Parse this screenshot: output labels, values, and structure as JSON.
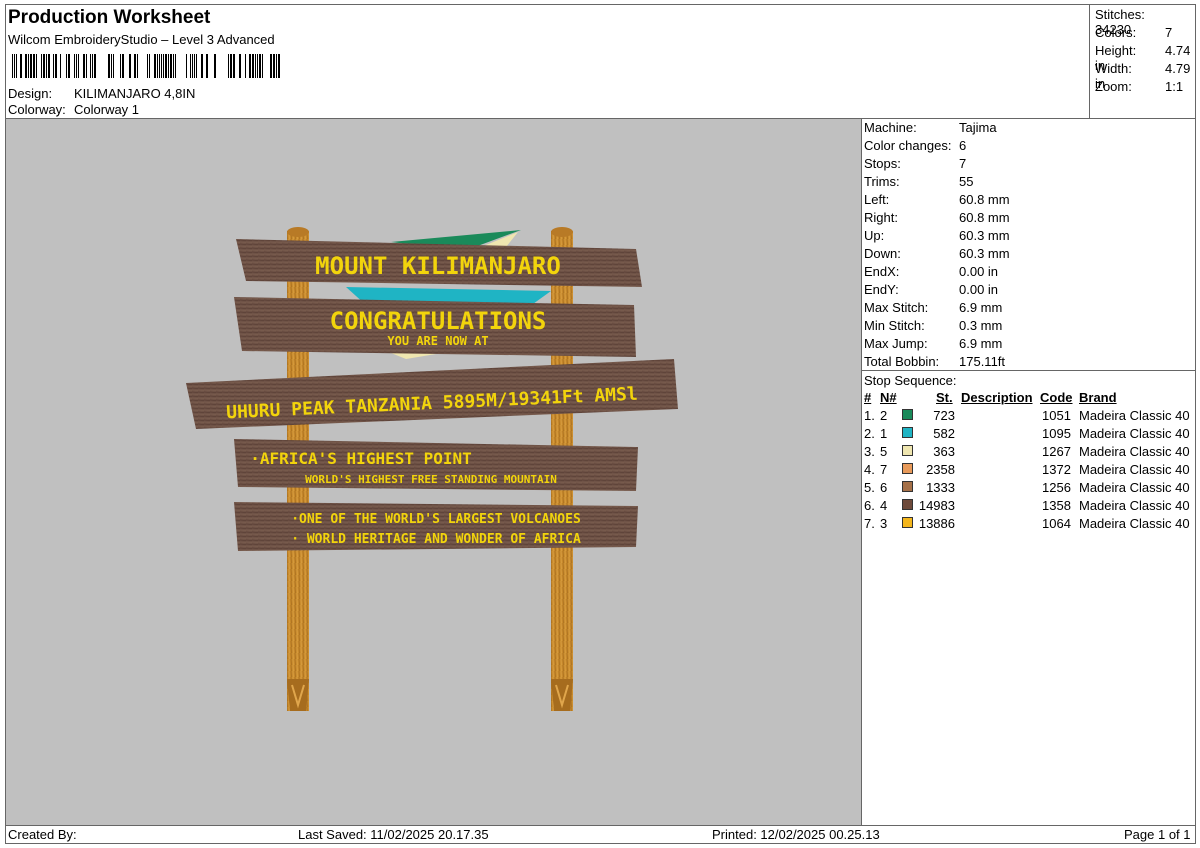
{
  "header": {
    "title": "Production Worksheet",
    "subtitle": "Wilcom EmbroideryStudio – Level 3 Advanced",
    "design_label": "Design:",
    "design_value": "KILIMANJARO 4,8IN",
    "colorway_label": "Colorway:",
    "colorway_value": "Colorway 1"
  },
  "summary": [
    {
      "label": "Stitches:",
      "value": "34230"
    },
    {
      "label": "Colors:",
      "value": "7"
    },
    {
      "label": "Height:",
      "value": "4.74 in"
    },
    {
      "label": "Width:",
      "value": "4.79 in"
    },
    {
      "label": "Zoom:",
      "value": "1:1"
    }
  ],
  "machine_info": [
    {
      "label": "Machine:",
      "value": "Tajima"
    },
    {
      "label": "Color changes:",
      "value": "6"
    },
    {
      "label": "Stops:",
      "value": "7"
    },
    {
      "label": "Trims:",
      "value": "55"
    },
    {
      "label": "Left:",
      "value": "60.8 mm"
    },
    {
      "label": "Right:",
      "value": "60.8 mm"
    },
    {
      "label": "Up:",
      "value": "60.3 mm"
    },
    {
      "label": "Down:",
      "value": "60.3 mm"
    },
    {
      "label": "EndX:",
      "value": "0.00 in"
    },
    {
      "label": "EndY:",
      "value": "0.00 in"
    },
    {
      "label": "Max Stitch:",
      "value": "6.9 mm"
    },
    {
      "label": "Min Stitch:",
      "value": "0.3 mm"
    },
    {
      "label": "Max Jump:",
      "value": "6.9 mm"
    },
    {
      "label": "Total Bobbin:",
      "value": "175.11ft"
    }
  ],
  "stop_sequence": {
    "title": "Stop Sequence:",
    "headers": {
      "seq": "#",
      "needle": "N#",
      "stitches": "St.",
      "description": "Description",
      "code": "Code",
      "brand": "Brand"
    },
    "rows": [
      {
        "seq": "1.",
        "needle": "2",
        "color": "#1a8a5a",
        "stitches": "723",
        "code": "1051",
        "brand": "Madeira Classic 40"
      },
      {
        "seq": "2.",
        "needle": "1",
        "color": "#1fb4c4",
        "stitches": "582",
        "code": "1095",
        "brand": "Madeira Classic 40"
      },
      {
        "seq": "3.",
        "needle": "5",
        "color": "#efe6b0",
        "stitches": "363",
        "code": "1267",
        "brand": "Madeira Classic 40"
      },
      {
        "seq": "4.",
        "needle": "7",
        "color": "#e89a5a",
        "stitches": "2358",
        "code": "1372",
        "brand": "Madeira Classic 40"
      },
      {
        "seq": "5.",
        "needle": "6",
        "color": "#a57048",
        "stitches": "1333",
        "code": "1256",
        "brand": "Madeira Classic 40"
      },
      {
        "seq": "6.",
        "needle": "4",
        "color": "#6e4a3a",
        "stitches": "14983",
        "code": "1358",
        "brand": "Madeira Classic 40"
      },
      {
        "seq": "7.",
        "needle": "3",
        "color": "#f4b61c",
        "stitches": "13886",
        "code": "1064",
        "brand": "Madeira Classic 40"
      }
    ]
  },
  "design": {
    "board_color": "#6e5246",
    "post_color": "#c88a2c",
    "text_color": "#f2d40c",
    "signs": {
      "line1": "MOUNT KILIMANJARO",
      "line2": "CONGRATULATIONS",
      "line3": "YOU ARE NOW AT",
      "line4": "UHURU PEAK TANZANIA 5895M/19341Ft AMSl",
      "line5": "·AFRICA'S HIGHEST POINT",
      "line6": "WORLD'S HIGHEST FREE STANDING MOUNTAIN",
      "line7": "·ONE OF THE WORLD'S LARGEST VOLCANOES",
      "line8": "· WORLD HERITAGE AND WONDER OF AFRICA"
    }
  },
  "footer": {
    "created_by": "Created By:",
    "last_saved": "Last Saved: 11/02/2025 20.17.35",
    "printed": "Printed: 12/02/2025 00.25.13",
    "page": "Page 1 of 1"
  }
}
